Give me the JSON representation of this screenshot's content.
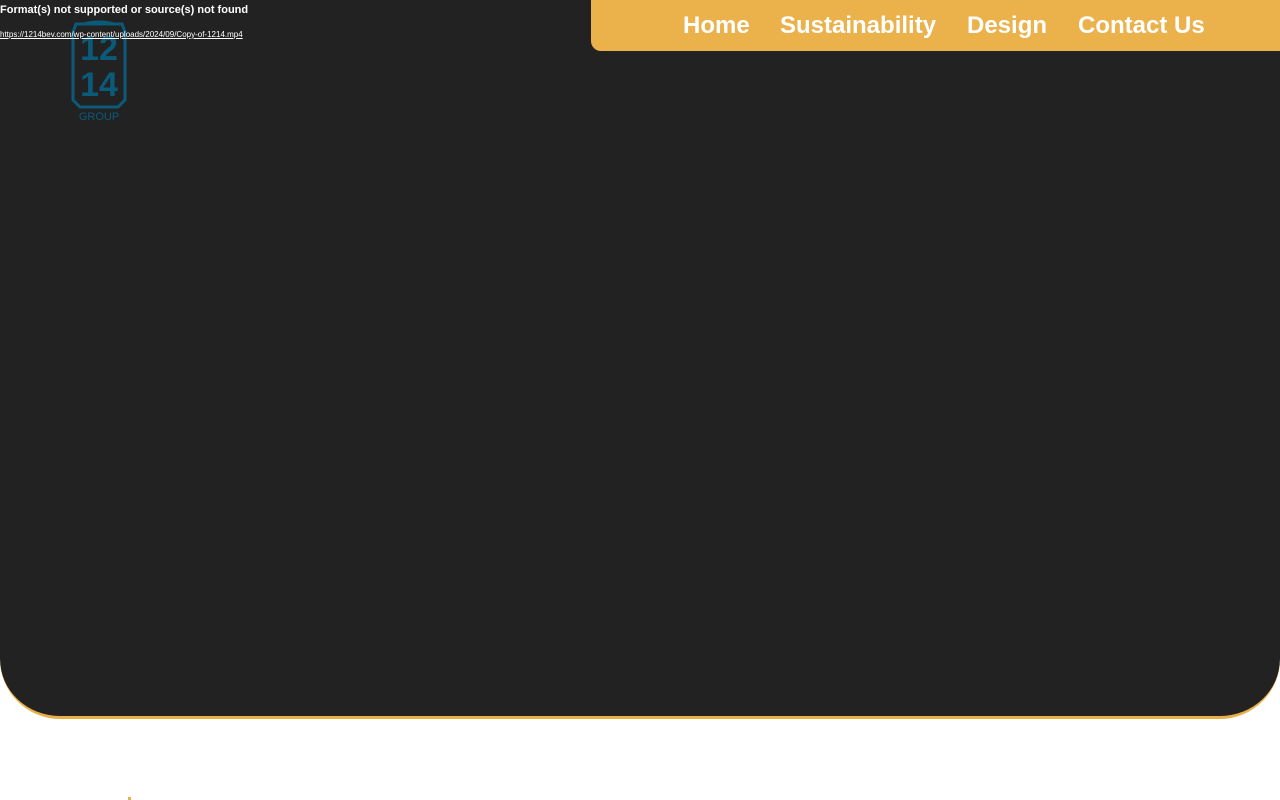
{
  "video": {
    "error_text": "Format(s) not supported or source(s) not found",
    "source_link": "https://1214bev.com/wp-content/uploads/2024/09/Copy-of-1214.mp4"
  },
  "logo": {
    "line1": "12",
    "line2": "14",
    "subtitle": "GROUP",
    "color": "#0b5a7a"
  },
  "nav": {
    "items": [
      {
        "label": "Home"
      },
      {
        "label": "Sustainability"
      },
      {
        "label": "Design"
      },
      {
        "label": "Contact Us"
      }
    ],
    "background": "#ebb14b"
  },
  "colors": {
    "hero_background": "#222222",
    "accent": "#e9b04a",
    "text_on_dark": "#ffffff"
  }
}
